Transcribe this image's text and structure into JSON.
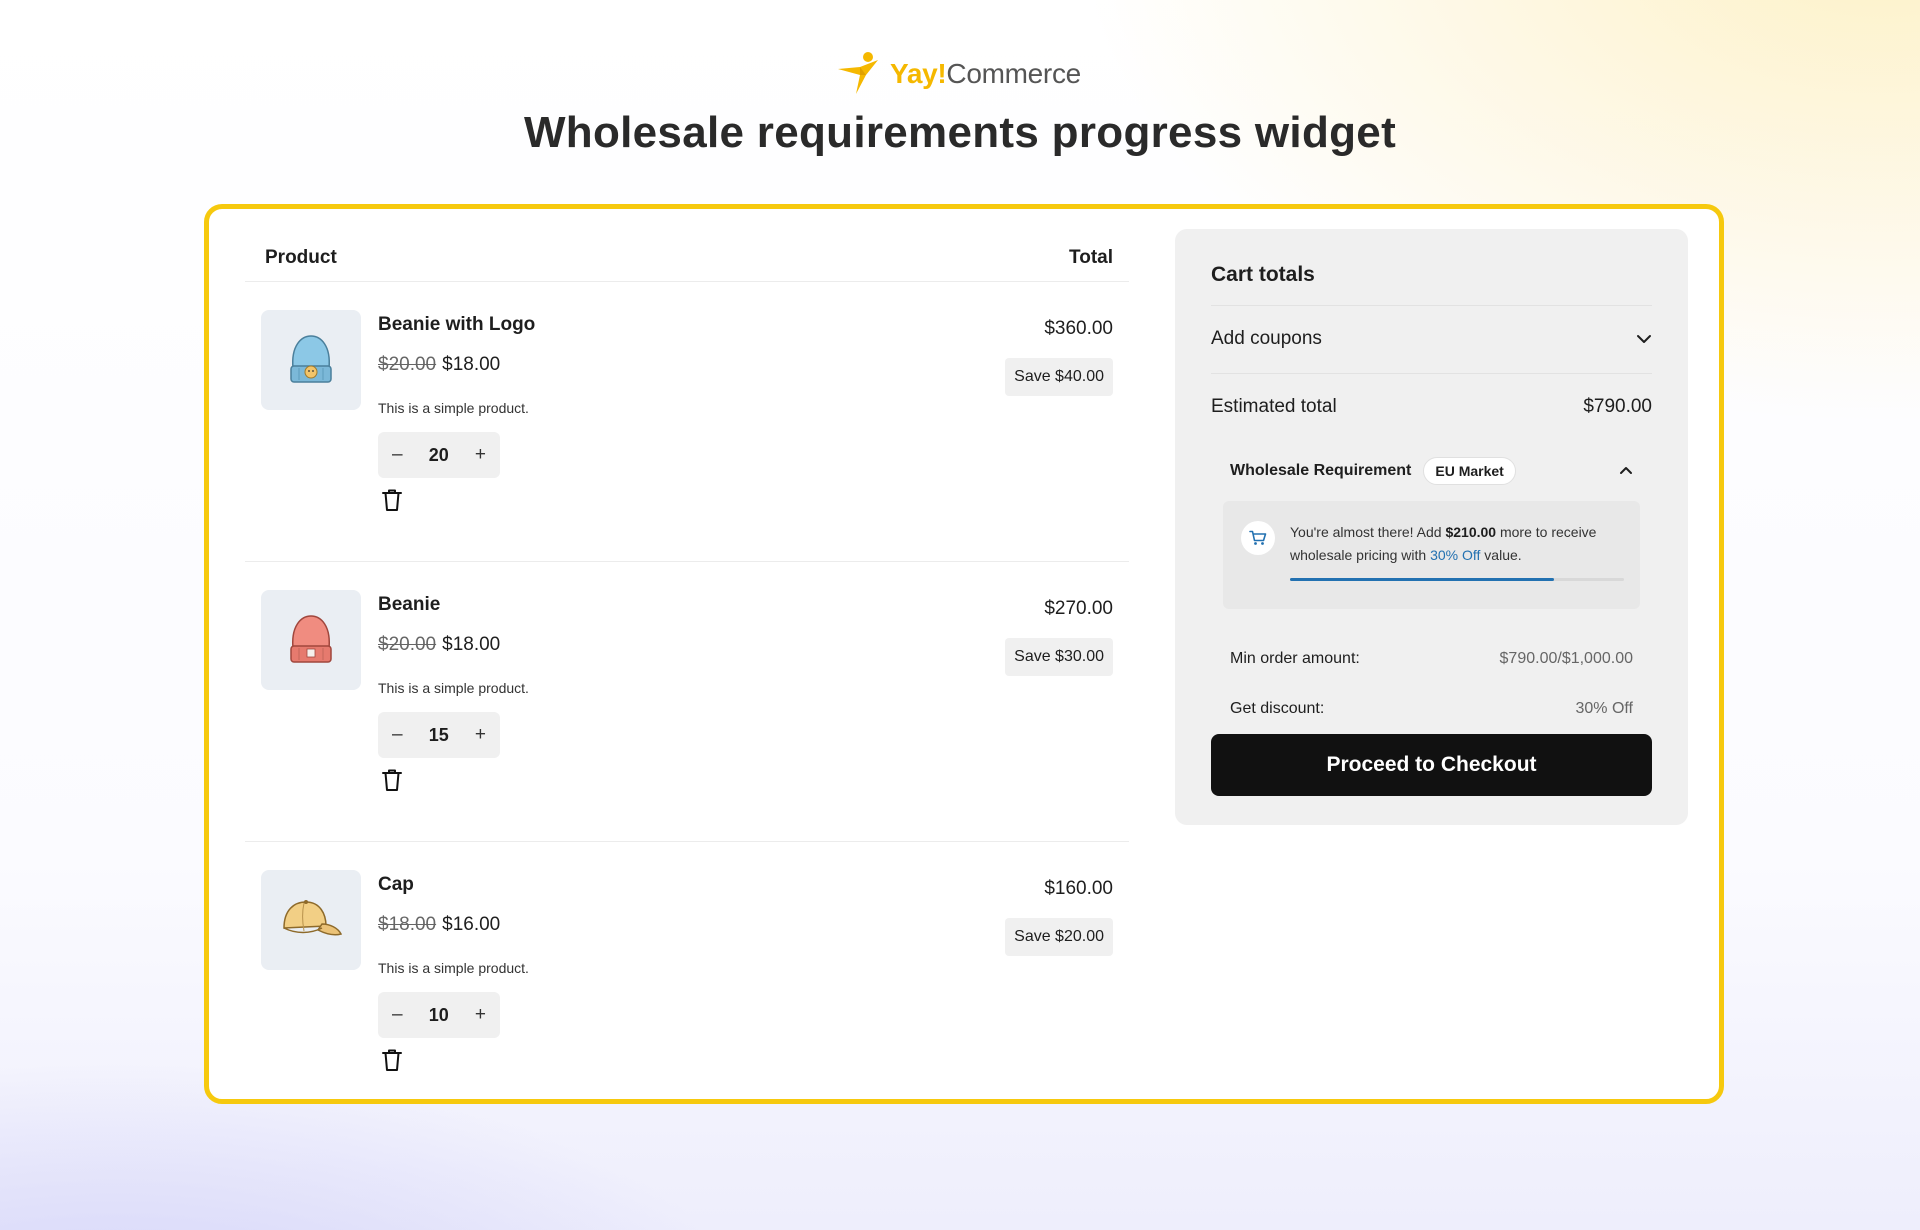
{
  "brand": {
    "name_part1": "Yay!",
    "name_part2": "Commerce",
    "accent": "#f5b800",
    "icon": "yay-runner-logo"
  },
  "page": {
    "title": "Wholesale requirements progress widget",
    "frame_border_color": "#f6c90e"
  },
  "cart": {
    "header": {
      "product": "Product",
      "total": "Total"
    },
    "items": [
      {
        "name": "Beanie with Logo",
        "old_price": "$20.00",
        "price": "$18.00",
        "description": "This is a simple product.",
        "qty": "20",
        "total": "$360.00",
        "save": "Save $40.00",
        "thumb_icon": "beanie-logo-icon",
        "thumb_color": "#8cc8e6"
      },
      {
        "name": "Beanie",
        "old_price": "$20.00",
        "price": "$18.00",
        "description": "This is a simple product.",
        "qty": "15",
        "total": "$270.00",
        "save": "Save $30.00",
        "thumb_icon": "beanie-icon",
        "thumb_color": "#f08c80"
      },
      {
        "name": "Cap",
        "old_price": "$18.00",
        "price": "$16.00",
        "description": "This is a simple product.",
        "qty": "10",
        "total": "$160.00",
        "save": "Save $20.00",
        "thumb_icon": "cap-icon",
        "thumb_color": "#f2cf85"
      }
    ],
    "qty_minus": "–",
    "qty_plus": "+"
  },
  "totals": {
    "title": "Cart totals",
    "coupons_label": "Add coupons",
    "estimated_label": "Estimated total",
    "estimated_value": "$790.00",
    "wholesale": {
      "title": "Wholesale Requirement",
      "badge": "EU Market",
      "msg_prefix": "You're almost there! Add ",
      "msg_amount": "$210.00",
      "msg_middle": " more to receive wholesale pricing with ",
      "msg_discount": "30% Off",
      "msg_suffix": " value.",
      "progress": 0.79,
      "progress_color": "#2271b1",
      "min_order_label": "Min order amount:",
      "min_order_value": "$790.00/$1,000.00",
      "discount_label": "Get discount:",
      "discount_value": "30% Off"
    },
    "checkout_label": "Proceed to Checkout"
  }
}
